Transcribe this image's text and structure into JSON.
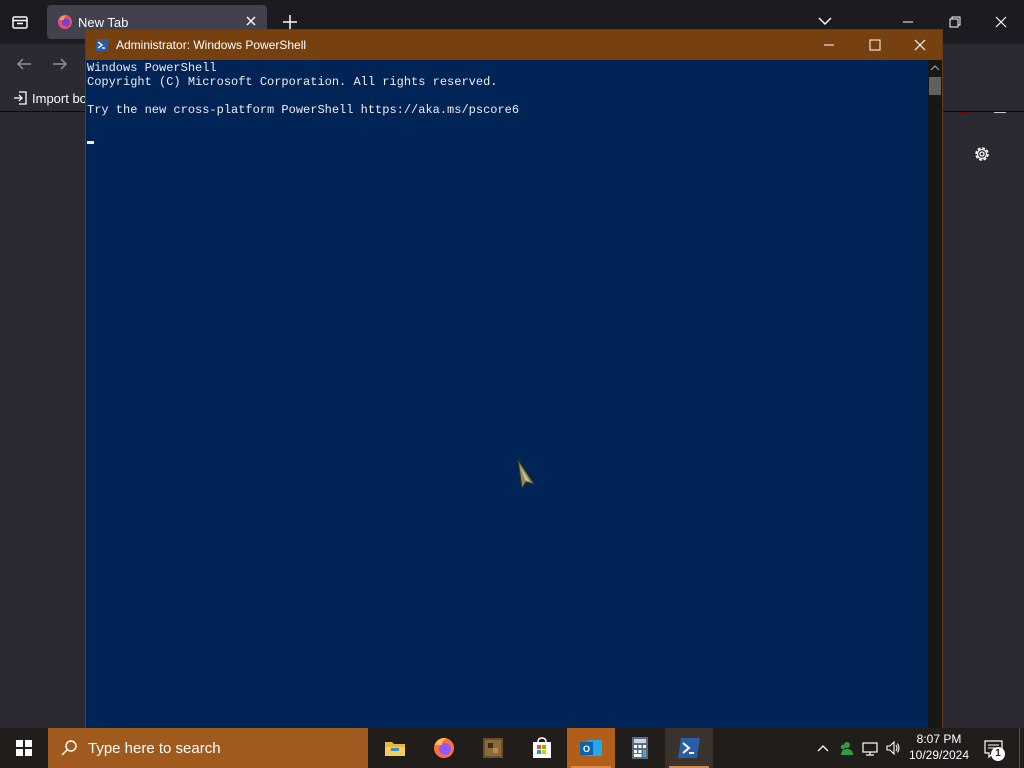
{
  "browser": {
    "tab_title": "New Tab",
    "bookmark_import_label": "Import bo"
  },
  "powershell": {
    "title": "Administrator: Windows PowerShell",
    "lines": [
      "Windows PowerShell",
      "Copyright (C) Microsoft Corporation. All rights reserved.",
      "",
      "Try the new cross-platform PowerShell https://aka.ms/pscore6"
    ],
    "background_color": "#012456",
    "titlebar_color": "#76400f"
  },
  "taskbar": {
    "search_placeholder": "Type here to search",
    "apps": [
      "file-explorer",
      "firefox",
      "minecraft",
      "microsoft-store",
      "outlook",
      "calculator",
      "powershell"
    ],
    "active_app": "outlook",
    "open_app": "powershell",
    "accent_color": "#a15a1e"
  },
  "tray": {
    "time": "8:07 PM",
    "date": "10/29/2024",
    "notification_count": "1"
  }
}
